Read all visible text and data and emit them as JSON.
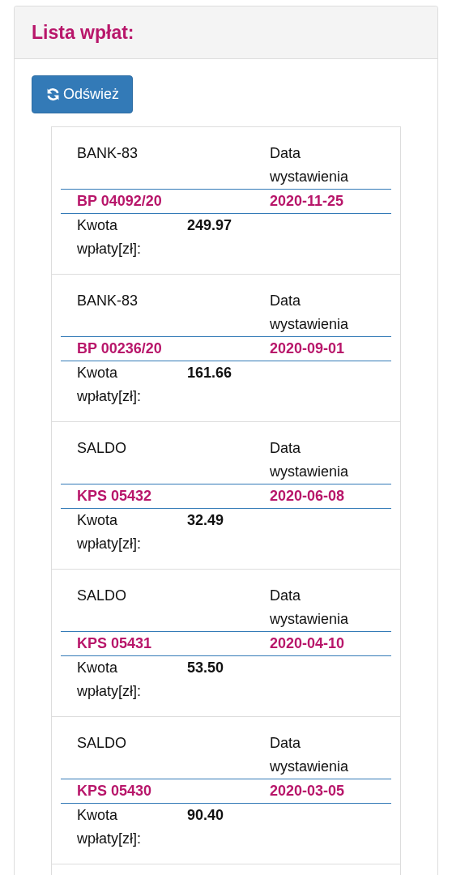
{
  "panel": {
    "title": "Lista wpłat:"
  },
  "refresh_button": {
    "label": "Odśwież"
  },
  "payments": [
    {
      "source": "BANK-83",
      "date_label": "Data wystawienia",
      "number": "BP 04092/20",
      "date": "2020-11-25",
      "amount_label": "Kwota wpłaty[zł]:",
      "amount": "249.97"
    },
    {
      "source": "BANK-83",
      "date_label": "Data wystawienia",
      "number": "BP 00236/20",
      "date": "2020-09-01",
      "amount_label": "Kwota wpłaty[zł]:",
      "amount": "161.66"
    },
    {
      "source": "SALDO",
      "date_label": "Data wystawienia",
      "number": "KPS 05432",
      "date": "2020-06-08",
      "amount_label": "Kwota wpłaty[zł]:",
      "amount": "32.49"
    },
    {
      "source": "SALDO",
      "date_label": "Data wystawienia",
      "number": "KPS 05431",
      "date": "2020-04-10",
      "amount_label": "Kwota wpłaty[zł]:",
      "amount": "53.50"
    },
    {
      "source": "SALDO",
      "date_label": "Data wystawienia",
      "number": "KPS 05430",
      "date": "2020-03-05",
      "amount_label": "Kwota wpłaty[zł]:",
      "amount": "90.40"
    }
  ]
}
